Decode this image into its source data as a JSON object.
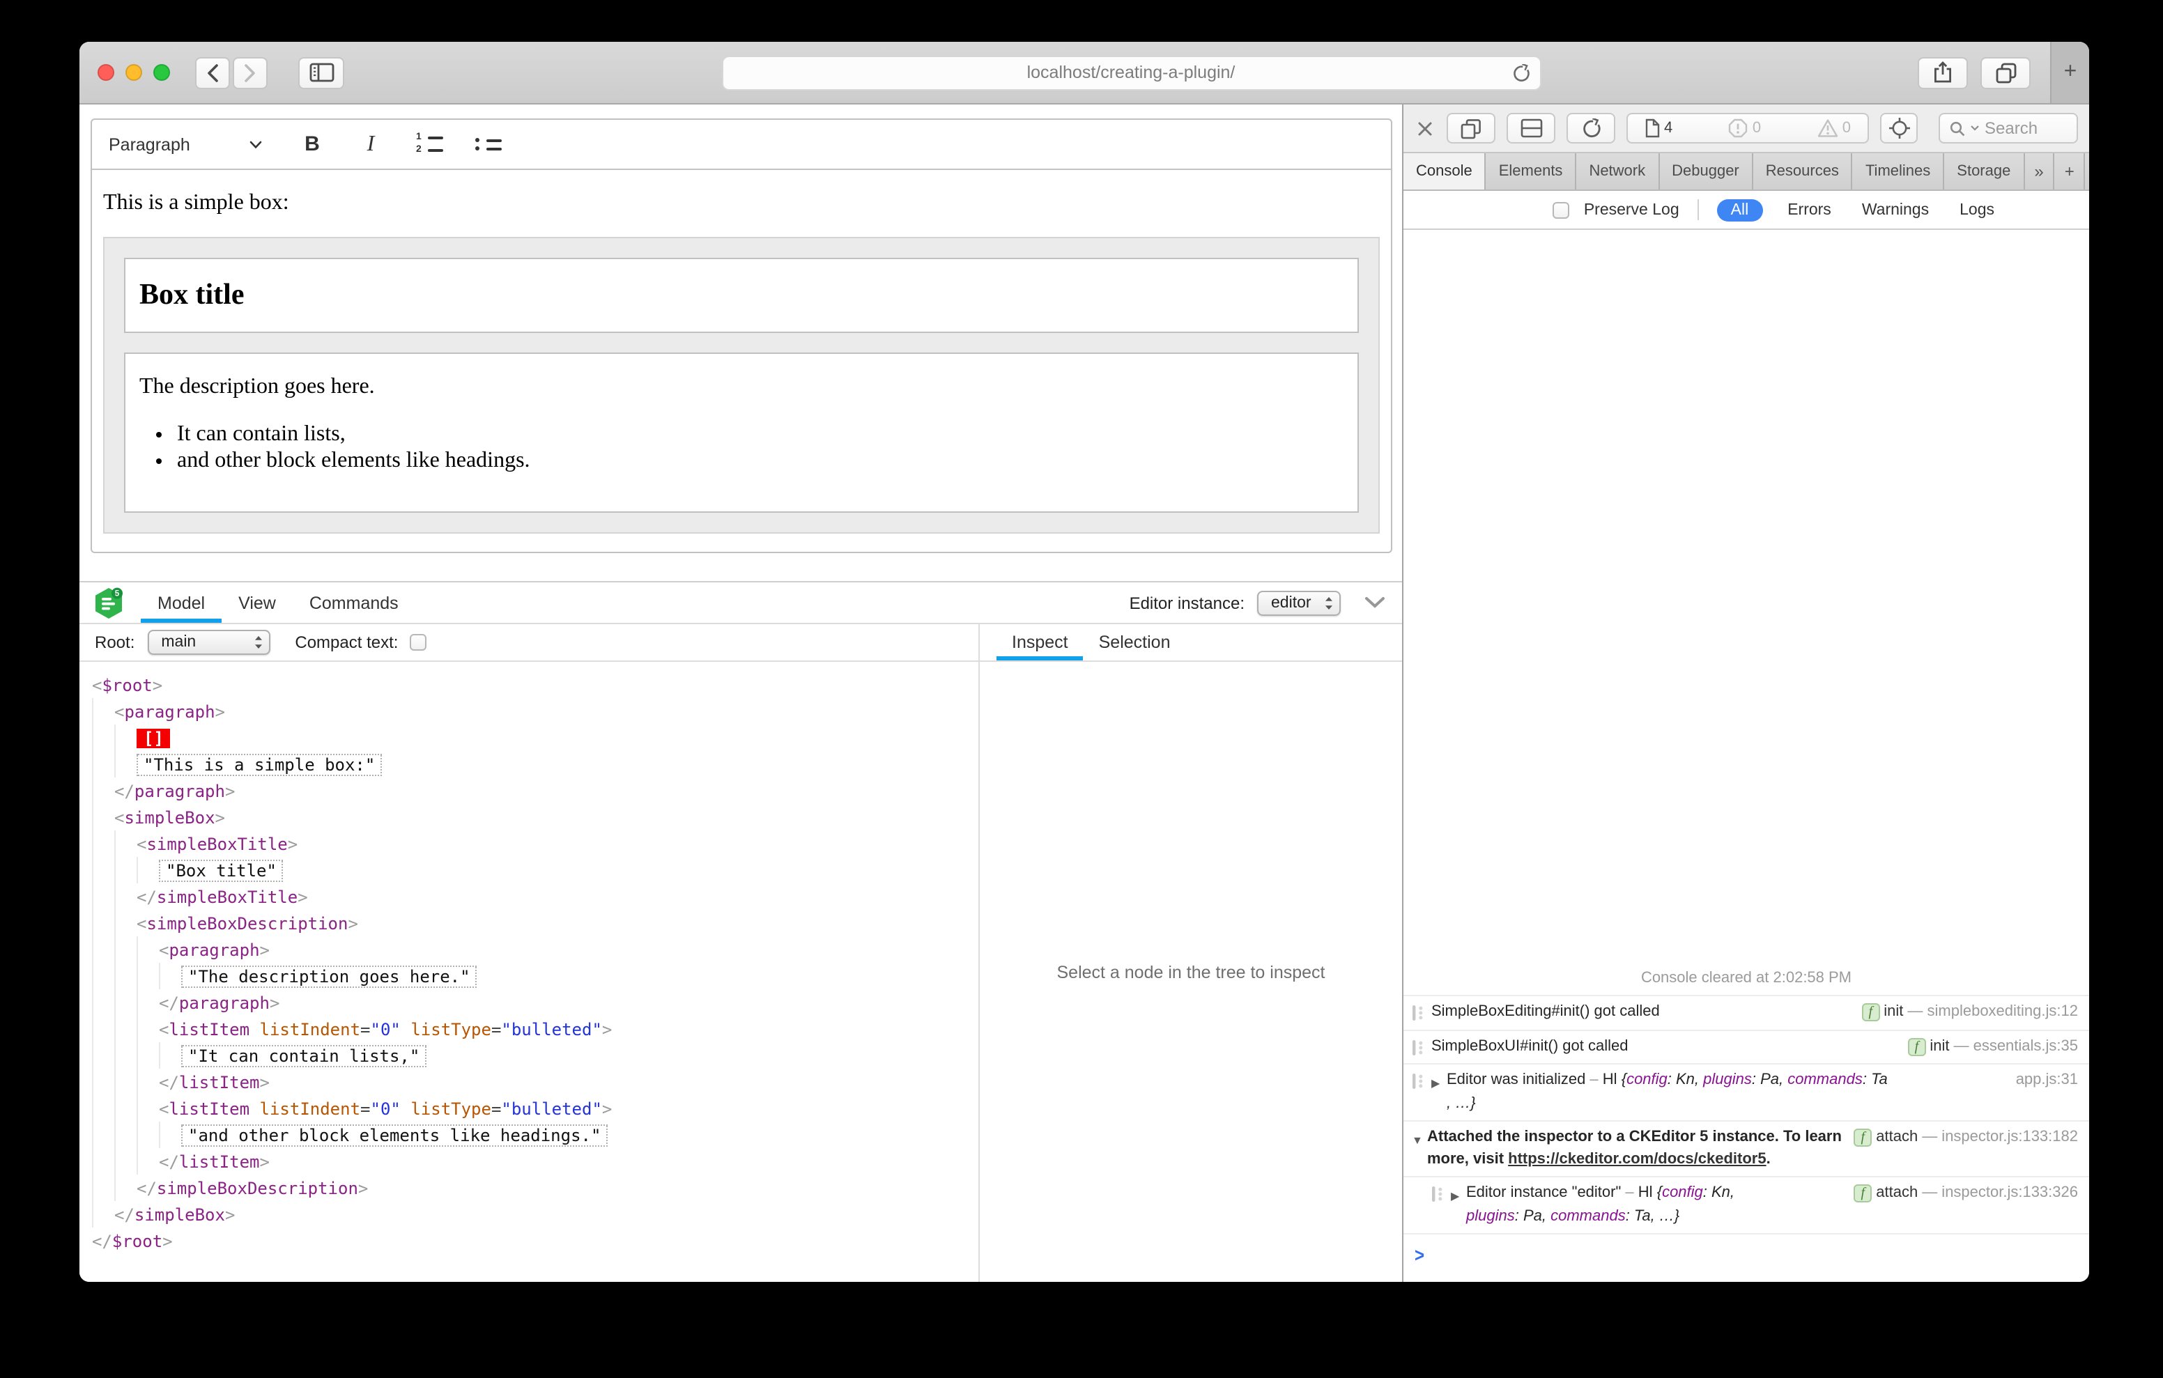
{
  "browser": {
    "url": "localhost/creating-a-plugin/",
    "new_tab_label": "+"
  },
  "editor": {
    "toolbar": {
      "style_dropdown": "Paragraph",
      "bold_label": "B",
      "italic_label": "I"
    },
    "content": {
      "intro": "This is a simple box:",
      "box_title": "Box title",
      "description": "The description goes here.",
      "list_items": [
        "It can contain lists,",
        "and other block elements like headings."
      ]
    }
  },
  "inspector": {
    "tabs": [
      "Model",
      "View",
      "Commands"
    ],
    "active_tab": "Model",
    "editor_instance_label": "Editor instance:",
    "editor_instance_value": "editor",
    "root_label": "Root:",
    "root_value": "main",
    "compact_text_label": "Compact text:",
    "compact_text_checked": false,
    "side_tabs": [
      "Inspect",
      "Selection"
    ],
    "active_side_tab": "Inspect",
    "empty_message": "Select a node in the tree to inspect",
    "tree": [
      {
        "i": 0,
        "k": "open",
        "n": "$root"
      },
      {
        "i": 1,
        "k": "open",
        "n": "paragraph"
      },
      {
        "i": 2,
        "k": "sel",
        "s": "[]"
      },
      {
        "i": 2,
        "k": "text",
        "s": "This is a simple box:"
      },
      {
        "i": 1,
        "k": "close",
        "n": "paragraph"
      },
      {
        "i": 1,
        "k": "open",
        "n": "simpleBox"
      },
      {
        "i": 2,
        "k": "open",
        "n": "simpleBoxTitle"
      },
      {
        "i": 3,
        "k": "text",
        "s": "Box title"
      },
      {
        "i": 2,
        "k": "close",
        "n": "simpleBoxTitle"
      },
      {
        "i": 2,
        "k": "open",
        "n": "simpleBoxDescription"
      },
      {
        "i": 3,
        "k": "open",
        "n": "paragraph"
      },
      {
        "i": 4,
        "k": "text",
        "s": "The description goes here."
      },
      {
        "i": 3,
        "k": "close",
        "n": "paragraph"
      },
      {
        "i": 3,
        "k": "open",
        "n": "listItem",
        "a": [
          [
            "listIndent",
            "0"
          ],
          [
            "listType",
            "bulleted"
          ]
        ]
      },
      {
        "i": 4,
        "k": "text",
        "s": "It can contain lists,"
      },
      {
        "i": 3,
        "k": "close",
        "n": "listItem"
      },
      {
        "i": 3,
        "k": "open",
        "n": "listItem",
        "a": [
          [
            "listIndent",
            "0"
          ],
          [
            "listType",
            "bulleted"
          ]
        ]
      },
      {
        "i": 4,
        "k": "text",
        "s": "and other block elements like headings."
      },
      {
        "i": 3,
        "k": "close",
        "n": "listItem"
      },
      {
        "i": 2,
        "k": "close",
        "n": "simpleBoxDescription"
      },
      {
        "i": 1,
        "k": "close",
        "n": "simpleBox"
      },
      {
        "i": 0,
        "k": "close",
        "n": "$root"
      }
    ]
  },
  "devtools": {
    "resources_count": "4",
    "errors_count": "0",
    "warnings_count": "0",
    "search_placeholder": "Search",
    "tabs": [
      "Console",
      "Elements",
      "Network",
      "Debugger",
      "Resources",
      "Timelines",
      "Storage"
    ],
    "active_tab": "Console",
    "more_tabs_label": "»",
    "add_tab_label": "+",
    "preserve_log_label": "Preserve Log",
    "preserve_log_checked": false,
    "scopes": [
      "All",
      "Errors",
      "Warnings",
      "Logs"
    ],
    "active_scope": "All",
    "cleared_message": "Console cleared at 2:02:58 PM",
    "prompt_symbol": ">",
    "logs": [
      {
        "icon": true,
        "parts": [
          {
            "k": "txt",
            "s": "SimpleBoxEditing#init() got called"
          }
        ],
        "right": {
          "badge": "f",
          "label": "init",
          "file": "simpleboxediting.js:12"
        }
      },
      {
        "icon": true,
        "parts": [
          {
            "k": "txt",
            "s": "SimpleBoxUI#init() got called"
          }
        ],
        "right": {
          "badge": "f",
          "label": "init",
          "file": "essentials.js:35"
        }
      },
      {
        "icon": true,
        "disclosure": "closed",
        "parts": [
          {
            "k": "txt",
            "s": "Editor was initialized"
          },
          {
            "k": "dim",
            "s": " – "
          },
          {
            "k": "txt",
            "s": "Hl "
          },
          {
            "k": "ital",
            "s": "{"
          },
          {
            "k": "key",
            "s": "config"
          },
          {
            "k": "ital",
            "s": ": Kn, "
          },
          {
            "k": "key",
            "s": "plugins"
          },
          {
            "k": "ital",
            "s": ": Pa, "
          },
          {
            "k": "key",
            "s": "commands"
          },
          {
            "k": "ital",
            "s": ": Ta"
          }
        ],
        "right": {
          "file": "app.js:31"
        },
        "line2": [
          {
            "k": "ital",
            "s": ", …}"
          }
        ]
      },
      {
        "icon": false,
        "disclosure": "open",
        "bold": true,
        "parts": [
          {
            "k": "txt",
            "s": "Attached the inspector to a CKEditor 5 instance. To learn more, visit "
          },
          {
            "k": "link",
            "s": "https://ckeditor.com/docs/ckeditor5"
          },
          {
            "k": "txt",
            "s": "."
          }
        ],
        "right": {
          "badge": "f",
          "label": "attach",
          "file": "inspector.js:133:182"
        }
      },
      {
        "icon": true,
        "disclosure": "closed",
        "child": true,
        "parts": [
          {
            "k": "txt",
            "s": "Editor instance \"editor\""
          },
          {
            "k": "dim",
            "s": " – "
          },
          {
            "k": "txt",
            "s": "Hl "
          },
          {
            "k": "ital",
            "s": "{"
          },
          {
            "k": "key",
            "s": "config"
          },
          {
            "k": "ital",
            "s": ": Kn,"
          }
        ],
        "right": {
          "badge": "f",
          "label": "attach",
          "file": "inspector.js:133:326"
        },
        "line2": [
          {
            "k": "key",
            "s": "plugins"
          },
          {
            "k": "ital",
            "s": ": Pa, "
          },
          {
            "k": "key",
            "s": "commands"
          },
          {
            "k": "ital",
            "s": ": Ta, …}"
          }
        ]
      }
    ]
  },
  "colors": {
    "filter_accent_blue": "#3f86f5",
    "inspector_accent_blue": "#12a0e8",
    "tree_tag_purple": "#8b2387",
    "tree_attr_name_orange": "#b75501",
    "tree_attr_value_blue": "#2433d8",
    "selection_marker_red": "#f40000",
    "badge_green_bg": "#d8eccf",
    "badge_green_fg": "#467f35",
    "object_key_purple": "#881391",
    "prompt_blue": "#2e6df6",
    "logo_green": "#2fb44b"
  }
}
